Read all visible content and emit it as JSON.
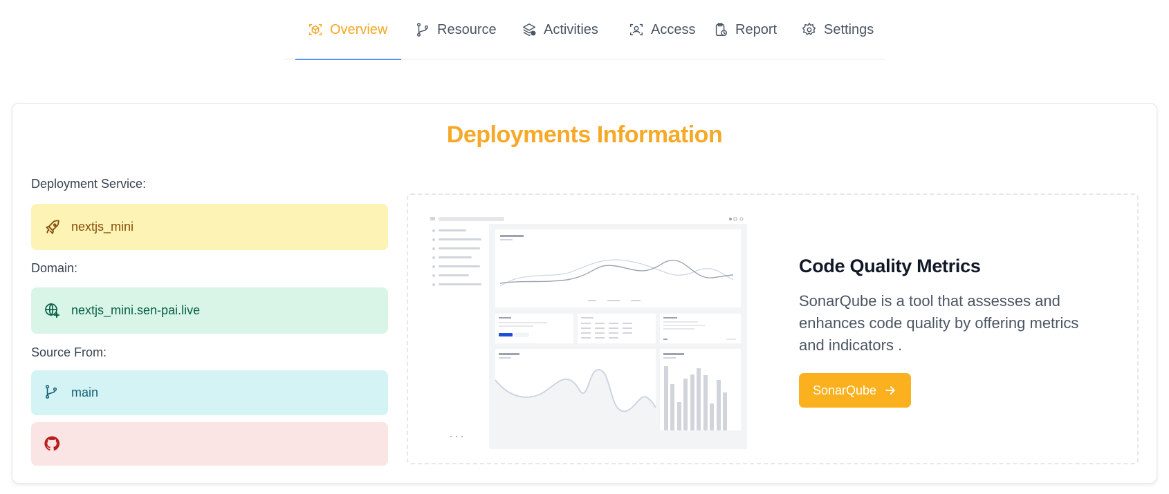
{
  "tabs": [
    {
      "label": "Overview",
      "icon": "box-scan-icon",
      "active": true
    },
    {
      "label": "Resource",
      "icon": "git-branch-icon",
      "active": false
    },
    {
      "label": "Activities",
      "icon": "layers-check-icon",
      "active": false
    },
    {
      "label": "Access",
      "icon": "user-scan-icon",
      "active": false
    },
    {
      "label": "Report",
      "icon": "clipboard-clock-icon",
      "active": false
    },
    {
      "label": "Settings",
      "icon": "gear-icon",
      "active": false
    }
  ],
  "card": {
    "title": "Deployments Information",
    "service_label": "Deployment Service:",
    "service_value": "nextjs_mini",
    "domain_label": "Domain:",
    "domain_value": "nextjs_mini.sen-pai.live",
    "source_label": "Source From:",
    "source_value": "main",
    "repo_value": ""
  },
  "metrics": {
    "title": "Code Quality Metrics",
    "description": "SonarQube is a tool that assesses and enhances code quality by offering metrics and indicators .",
    "button_label": "SonarQube"
  },
  "colors": {
    "accent": "#f6a928",
    "tab_underline": "#5b8def",
    "button": "#fbb11f"
  }
}
